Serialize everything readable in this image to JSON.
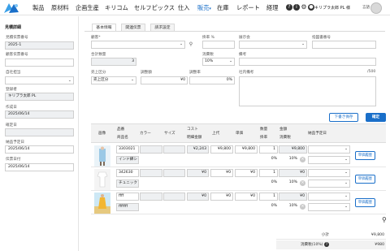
{
  "nav": {
    "items": [
      "製品",
      "原材料",
      "企画生産",
      "キリコム",
      "セルフピックス",
      "仕入",
      "販売",
      "在庫",
      "レポート",
      "経理"
    ],
    "active": "販売",
    "user": "キリプラ太郎 PL 様",
    "lang": "言語"
  },
  "sidebar": {
    "title": "見積詳細",
    "fields": [
      {
        "label": "見積伝票番号",
        "value": "2025-1",
        "readonly": true
      },
      {
        "label": "顧客伝票番号",
        "value": "",
        "readonly": false
      },
      {
        "label": "自社担当",
        "value": "",
        "readonly": false,
        "select": true
      },
      {
        "label": "登録者",
        "value": "キリプラ太郎 PL",
        "readonly": true
      },
      {
        "label": "作成日",
        "value": "2025/06/14",
        "readonly": true
      },
      {
        "label": "確定日",
        "value": "",
        "readonly": true
      },
      {
        "label": "納品予定日",
        "value": "2025/06/14",
        "readonly": false
      },
      {
        "label": "伝票日付",
        "value": "2025/06/14",
        "readonly": false
      }
    ]
  },
  "tabs": [
    "基本情報",
    "関連伝票",
    "請求設定"
  ],
  "form": {
    "customer_label": "顧客*",
    "rate_label": "掛率 %",
    "showroom_label": "展示会",
    "designated_no_label": "指図書番号",
    "total_qty_label": "合計数量",
    "total_qty": "3",
    "tax_label": "消費税",
    "tax_value": "10%",
    "remarks_label": "備考",
    "sales_type_label": "売上区分",
    "sales_type_value": "売上区分",
    "adjust_amount_label": "調整額",
    "adjust_amount": "¥0",
    "adjust_rate_label": "調整率",
    "adjust_rate": "0%",
    "internal_remarks_label": "社内備考",
    "internal_remarks_count": "/500"
  },
  "buttons": {
    "draft": "下書き保存",
    "confirm": "確定"
  },
  "table": {
    "headers": {
      "image": "画像",
      "product_no": "品番",
      "product_name": "商品名",
      "color": "カラー",
      "size": "サイズ",
      "cost": "コスト",
      "detail_amount": "明細金額",
      "upper": "上代",
      "unit_price": "単価",
      "qty": "数量",
      "rate": "掛率",
      "amount": "金額",
      "tax": "消費税",
      "delivery": "納品予定日"
    },
    "rows": [
      {
        "product_no": "3303021",
        "product_name": "インド綿シ",
        "cost": "¥2,243",
        "upper": "¥9,800",
        "unit_price": "¥9,800",
        "qty": "1",
        "rate": "0%",
        "amount": "¥9,800",
        "tax": "10%",
        "history": "単価履歴"
      },
      {
        "product_no": "342630",
        "product_name": "チュニック",
        "cost": "¥0",
        "upper": "¥0",
        "unit_price": "¥0",
        "qty": "1",
        "rate": "0%",
        "amount": "¥0",
        "tax": "10%",
        "history": "単価履歴"
      },
      {
        "product_no": "ffff",
        "product_name": "fffffff",
        "cost": "¥0",
        "upper": "¥0",
        "unit_price": "¥0",
        "qty": "1",
        "rate": "0%",
        "amount": "¥0",
        "tax": "10%",
        "history": "単価履歴"
      }
    ]
  },
  "summary": {
    "subtotal_label": "小計",
    "subtotal": "¥9,800",
    "tax_label": "消費税(10%)",
    "tax": "¥980"
  },
  "colors": {
    "accent": "#1a6fc9",
    "readonly_bg": "#eef0f2"
  }
}
